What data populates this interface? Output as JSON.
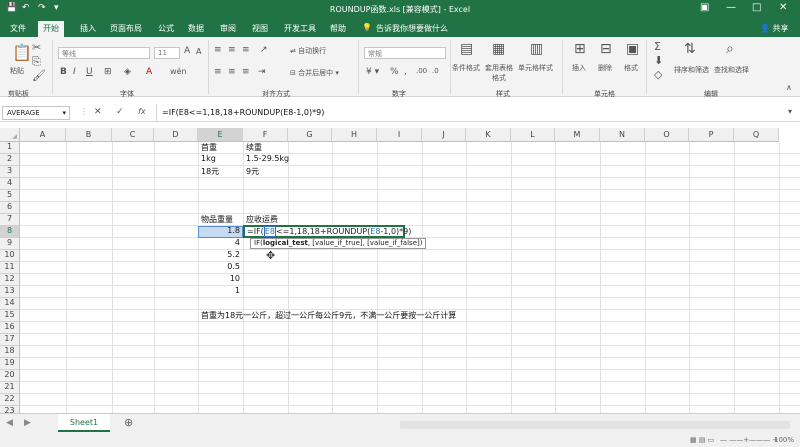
{
  "window": {
    "title": "ROUNDUP函数.xls [兼容模式] - Excel"
  },
  "quick_access": {
    "save": "💾",
    "undo": "↶",
    "redo": "↷",
    "customize": "▾"
  },
  "window_controls": {
    "ribbon_opts": "▣",
    "minimize": "—",
    "maximize": "□",
    "close": "✕"
  },
  "menu": {
    "tabs": [
      "文件",
      "开始",
      "插入",
      "页面布局",
      "公式",
      "数据",
      "审阅",
      "视图",
      "开发工具",
      "帮助"
    ],
    "active": "开始",
    "tell_me": "告诉我你想要做什么",
    "share": "共享"
  },
  "ribbon": {
    "groups": [
      "剪贴板",
      "字体",
      "对齐方式",
      "数字",
      "样式",
      "单元格",
      "编辑"
    ],
    "paste": "粘贴",
    "font_name": "等线",
    "font_size": "11",
    "wrap": "自动换行",
    "merge": "合并后居中",
    "number_format": "常规",
    "cond_format": "条件格式",
    "table_format": "套用表格格式",
    "cell_style": "单元格样式",
    "insert": "插入",
    "delete": "删除",
    "format": "格式",
    "sort_filter": "排序和筛选",
    "find_select": "查找和选择"
  },
  "formula_bar": {
    "name_box": "AVERAGE",
    "cancel": "✕",
    "confirm": "✓",
    "fx": "fx",
    "formula": "=IF(E8<=1,18,18+ROUNDUP(E8-1,0)*9)"
  },
  "columns": [
    "A",
    "B",
    "C",
    "D",
    "E",
    "F",
    "G",
    "H",
    "I",
    "J",
    "K",
    "L",
    "M",
    "N",
    "O",
    "P",
    "Q"
  ],
  "rows": [
    "1",
    "2",
    "3",
    "4",
    "5",
    "6",
    "7",
    "8",
    "9",
    "10",
    "11",
    "12",
    "13",
    "14",
    "15",
    "16",
    "17",
    "18",
    "19",
    "20",
    "21",
    "22",
    "23"
  ],
  "cells": {
    "e1": "首重",
    "f1": "续重",
    "e2": "1kg",
    "f2": "1.5-29.5kg",
    "e3": "18元",
    "f3": "9元",
    "e7": "物品重量",
    "f7": "应收运费",
    "e8": "1.8",
    "e9": "4",
    "e10": "5.2",
    "e11": "0.5",
    "e12": "10",
    "e13": "1",
    "e15": "首重为18元一公斤，超过一公斤每公斤9元，不满一公斤要按一公斤计算"
  },
  "edit": {
    "p1": "=IF(",
    "p2": "E8",
    "p3": "<=1",
    "p4": ",18,18+ROUNDUP(",
    "p5": "E8",
    "p6": "-1,0)*9)"
  },
  "tooltip": {
    "fn": "IF(",
    "arg1": "logical_test",
    "rest": ", [value_if_true], [value_if_false])"
  },
  "sheets": {
    "active": "Sheet1",
    "add": "⊕"
  },
  "status": {
    "zoom": "100%"
  },
  "colors": {
    "brand": "#217346"
  }
}
